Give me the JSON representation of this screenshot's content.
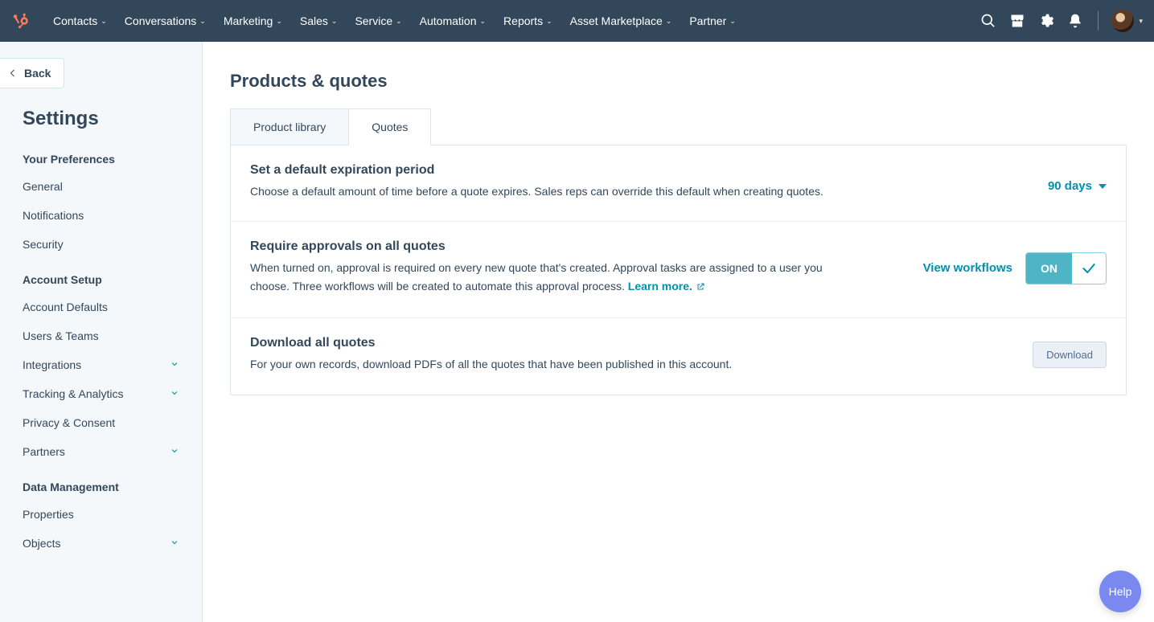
{
  "topnav": {
    "items": [
      "Contacts",
      "Conversations",
      "Marketing",
      "Sales",
      "Service",
      "Automation",
      "Reports",
      "Asset Marketplace",
      "Partner"
    ]
  },
  "sidebar": {
    "back_label": "Back",
    "title": "Settings",
    "sections": [
      {
        "label": "Your Preferences",
        "items": [
          {
            "label": "General",
            "expandable": false
          },
          {
            "label": "Notifications",
            "expandable": false
          },
          {
            "label": "Security",
            "expandable": false
          }
        ]
      },
      {
        "label": "Account Setup",
        "items": [
          {
            "label": "Account Defaults",
            "expandable": false
          },
          {
            "label": "Users & Teams",
            "expandable": false
          },
          {
            "label": "Integrations",
            "expandable": true
          },
          {
            "label": "Tracking & Analytics",
            "expandable": true
          },
          {
            "label": "Privacy & Consent",
            "expandable": false
          },
          {
            "label": "Partners",
            "expandable": true
          }
        ]
      },
      {
        "label": "Data Management",
        "items": [
          {
            "label": "Properties",
            "expandable": false
          },
          {
            "label": "Objects",
            "expandable": true
          }
        ]
      }
    ]
  },
  "main": {
    "title": "Products & quotes",
    "tabs": [
      {
        "label": "Product library"
      },
      {
        "label": "Quotes"
      }
    ],
    "active_tab": 1,
    "settings": {
      "expiration": {
        "title": "Set a default expiration period",
        "desc": "Choose a default amount of time before a quote expires. Sales reps can override this default when creating quotes.",
        "value": "90 days"
      },
      "approvals": {
        "title": "Require approvals on all quotes",
        "desc_pre": "When turned on, approval is required on every new quote that's created. Approval tasks are assigned to a user you choose. Three workflows will be created to automate this approval process. ",
        "learn_more_label": "Learn more.",
        "view_workflows_label": "View workflows",
        "toggle_on_label": "ON"
      },
      "download": {
        "title": "Download all quotes",
        "desc": "For your own records, download PDFs of all the quotes that have been published in this account.",
        "button_label": "Download"
      }
    }
  },
  "help_label": "Help"
}
